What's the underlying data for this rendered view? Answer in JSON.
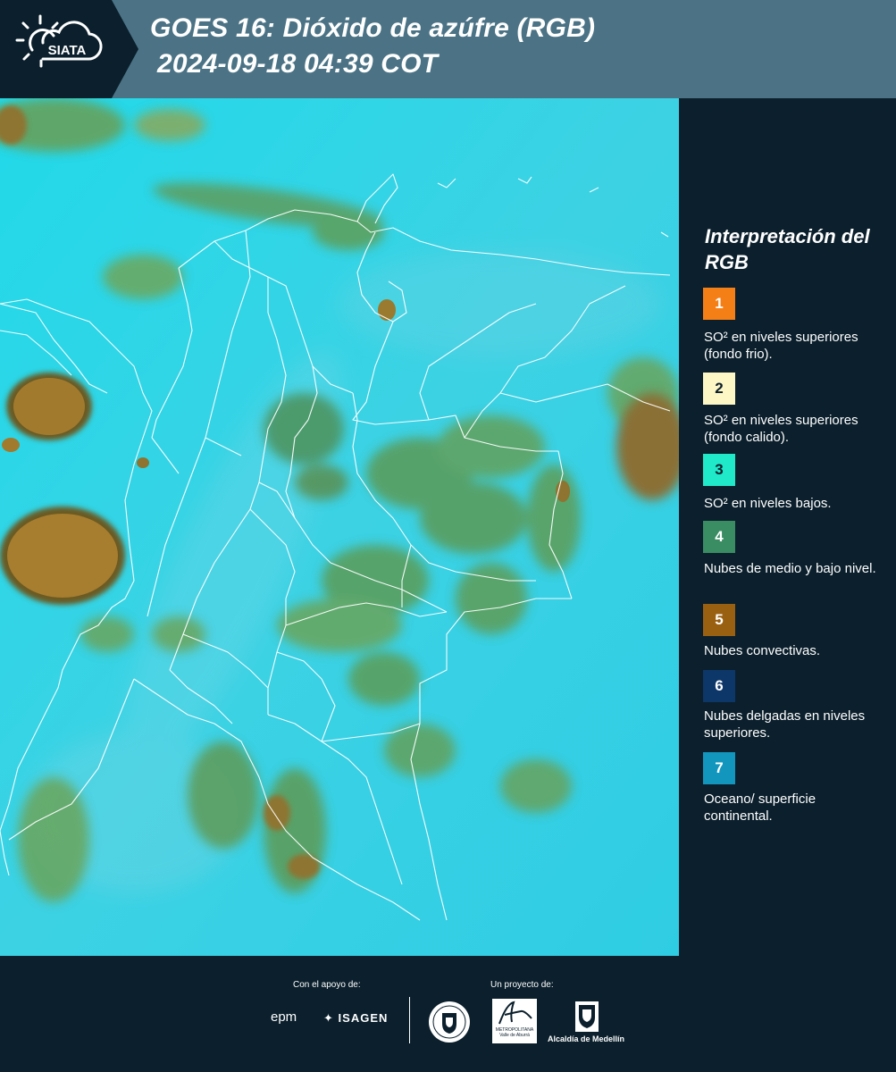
{
  "header": {
    "logo_text": "SIATA",
    "title_line1": "GOES 16: Dióxido de azúfre (RGB)",
    "title_line2": "2024-09-18 04:39 COT"
  },
  "legend": {
    "title": "Interpretación del RGB",
    "items": [
      {
        "num": "1",
        "label": "SO² en niveles superiores (fondo frio).",
        "color": "#f57f17"
      },
      {
        "num": "2",
        "label": "SO² en niveles superiores (fondo calido).",
        "color": "#fdf6c5"
      },
      {
        "num": "3",
        "label": "SO² en niveles bajos.",
        "color": "#1fe9c9"
      },
      {
        "num": "4",
        "label": "Nubes de medio y bajo nivel.",
        "color": "#3a8c63"
      },
      {
        "num": "5",
        "label": "Nubes convectivas.",
        "color": "#9a6012"
      },
      {
        "num": "6",
        "label": "Nubes delgadas en niveles superiores.",
        "color": "#0d3769"
      },
      {
        "num": "7",
        "label": "Oceano/ superficie continental.",
        "color": "#1296be"
      }
    ]
  },
  "footer": {
    "support_label": "Con el apoyo de:",
    "project_label": "Un proyecto de:",
    "epm": "epm",
    "isagen": "ISAGEN",
    "amva_text": "METROPOLITANA Valle de Aburrá",
    "alcaldia": "Alcaldía de Medellín"
  },
  "colors": {
    "header_bg": "#4b7385",
    "panel_bg": "#0b1f2c",
    "map_base": "#33d6e6"
  }
}
